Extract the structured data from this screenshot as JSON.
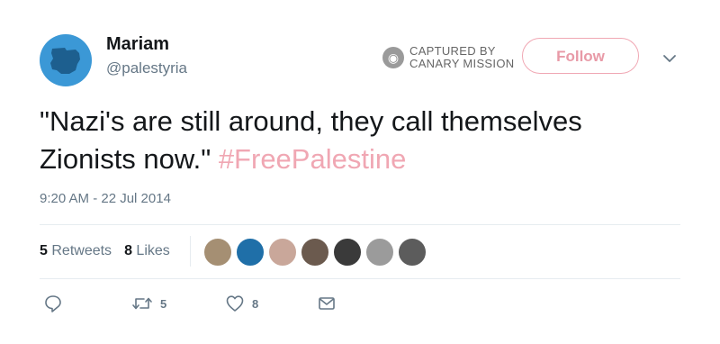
{
  "user": {
    "name": "Mariam",
    "handle": "@palestyria"
  },
  "watermark": {
    "line1": "CAPTURED BY",
    "line2": "CANARY MISSION",
    "icon": "canary-bird-icon"
  },
  "follow_label": "Follow",
  "tweet": {
    "text": "\"Nazi's are still around, they call themselves Zionists now.\" ",
    "hashtag": "#FreePalestine"
  },
  "timestamp": "9:20 AM - 22 Jul 2014",
  "stats": {
    "retweets_count": "5",
    "retweets_label": "Retweets",
    "likes_count": "8",
    "likes_label": "Likes"
  },
  "likers": [
    {
      "color": "#a58f73"
    },
    {
      "color": "#1f6fa8"
    },
    {
      "color": "#c9a79a"
    },
    {
      "color": "#6b5a4e"
    },
    {
      "color": "#3a3a3a"
    },
    {
      "color": "#9b9b9b"
    },
    {
      "color": "#5c5c5c"
    }
  ],
  "actions": {
    "reply_icon": "reply-icon",
    "retweet_icon": "retweet-icon",
    "retweet_count": "5",
    "like_icon": "heart-icon",
    "like_count": "8",
    "dm_icon": "envelope-icon"
  },
  "colors": {
    "accent": "#f0a7b3",
    "avatar_bg": "#3b98d6",
    "muted": "#657786",
    "text": "#14171a"
  }
}
